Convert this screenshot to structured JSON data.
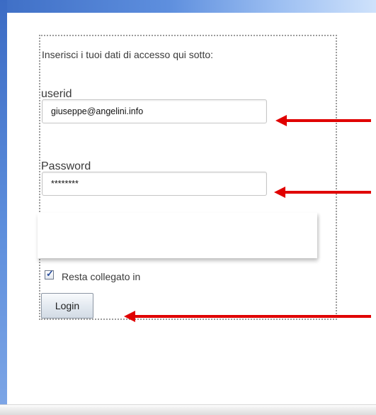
{
  "login": {
    "instructions": "Inserisci i tuoi dati di accesso qui sotto:",
    "userid_label": "userid",
    "userid_value": "giuseppe@angelini.info",
    "password_label": "Password",
    "password_value": "********",
    "remember_label": "Resta collegato in",
    "remember_checked": true,
    "login_button_label": "Login"
  },
  "annotations": {
    "arrow_color": "#e00000"
  },
  "icons": {
    "checkbox_checked": "check-mark-icon",
    "arrow": "arrow-left-icon"
  }
}
